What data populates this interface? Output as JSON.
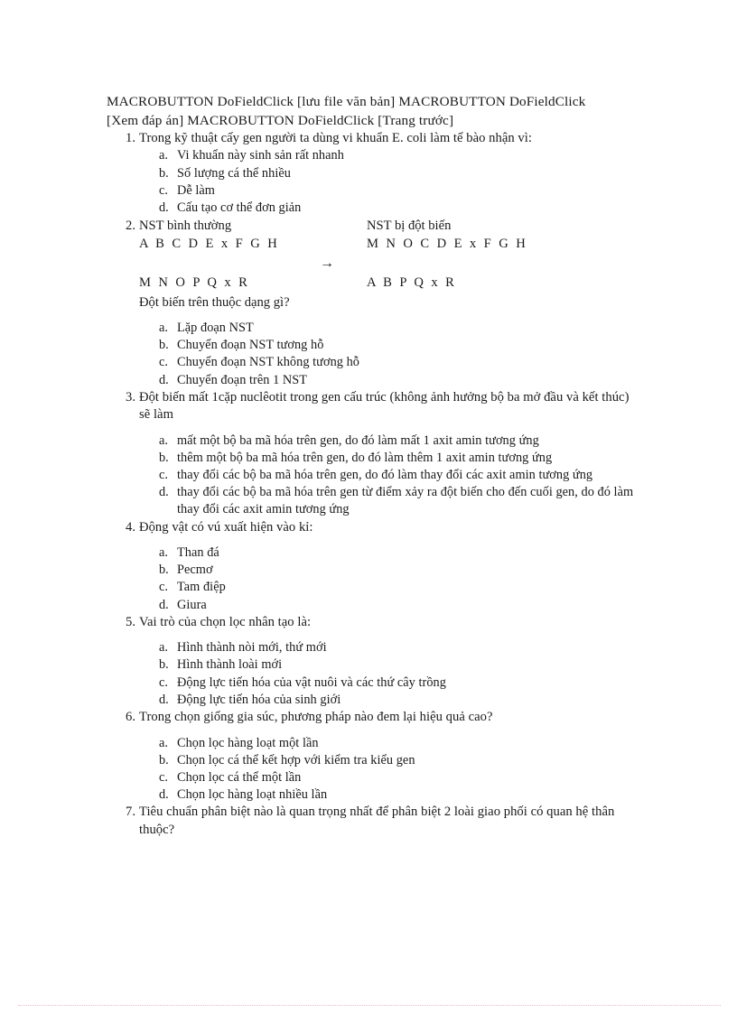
{
  "document": {
    "header_lines": [
      "MACROBUTTON DoFieldClick   [lưu file văn bản] MACROBUTTON DoFieldClick",
      "[Xem đáp án] MACROBUTTON DoFieldClick   [Trang trước]"
    ],
    "questions": [
      {
        "number": "1.",
        "text": "Trong kỹ thuật cấy gen người ta dùng vi khuẩn E. coli làm tế bào nhận vì:",
        "options": [
          {
            "letter": "a.",
            "text": "Vi khuẩn này sinh sản rất nhanh"
          },
          {
            "letter": "b.",
            "text": "Số lượng cá thể nhiều"
          },
          {
            "letter": "c.",
            "text": "Dễ làm"
          },
          {
            "letter": "d.",
            "text": "Cấu tạo cơ thể đơn giản"
          }
        ]
      },
      {
        "number": "2.",
        "text": "NST bình thường",
        "diagram": {
          "label_left": "NST bình thường",
          "label_right": "NST bị đột biến",
          "seq_left_top": "A B C D E x F G H",
          "seq_right_top": "M N O C D E x F G H",
          "arrow": "→",
          "seq_left_bottom": "M N O P Q x R",
          "seq_right_bottom": "A B P Q x R",
          "prompt": "Đột biến trên thuộc dạng gì?"
        },
        "options": [
          {
            "letter": "a.",
            "text": "Lặp đoạn NST"
          },
          {
            "letter": "b.",
            "text": "Chuyển đoạn NST tương hỗ"
          },
          {
            "letter": "c.",
            "text": "Chuyển đoạn NST không tương hỗ"
          },
          {
            "letter": "d.",
            "text": "Chuyển đoạn trên 1 NST"
          }
        ]
      },
      {
        "number": "3.",
        "text": "Đột biến mất 1cặp nuclêotit  trong gen cấu trúc (không ảnh hưởng bộ ba mở đầu và kết thúc) sẽ làm",
        "options": [
          {
            "letter": "a.",
            "text": "mất một bộ ba mã hóa trên gen, do đó làm mất 1 axit amin tương ứng"
          },
          {
            "letter": "b.",
            "text": "thêm một bộ ba mã hóa trên gen, do đó làm thêm 1 axit amin tương ứng"
          },
          {
            "letter": "c.",
            "text": "thay đổi các bộ ba mã hóa trên gen, do đó làm thay đổi các axit amin tương ứng"
          },
          {
            "letter": "d.",
            "text": "thay đổi các bộ ba mã hóa trên gen từ điểm xảy ra đột biến cho đến cuối gen, do đó làm thay đổi các axit amin tương ứng"
          }
        ]
      },
      {
        "number": "4.",
        "text": "Động vật có vú xuất hiện vào kỉ:",
        "options": [
          {
            "letter": "a.",
            "text": "Than đá"
          },
          {
            "letter": "b.",
            "text": "Pecmơ"
          },
          {
            "letter": "c.",
            "text": "Tam điệp"
          },
          {
            "letter": "d.",
            "text": "Giura"
          }
        ]
      },
      {
        "number": "5.",
        "text": "Vai trò của chọn lọc nhân tạo là:",
        "options": [
          {
            "letter": "a.",
            "text": "Hình thành nòi mới, thứ mới"
          },
          {
            "letter": "b.",
            "text": "Hình thành loài mới"
          },
          {
            "letter": "c.",
            "text": "Động lực tiến hóa của vật nuôi và các thứ cây trồng"
          },
          {
            "letter": "d.",
            "text": "Động lực tiến hóa của sinh giới"
          }
        ]
      },
      {
        "number": "6.",
        "text": "Trong chọn giống gia súc, phương pháp nào đem lại hiệu quả cao?",
        "options": [
          {
            "letter": "a.",
            "text": "Chọn lọc hàng loạt một lần"
          },
          {
            "letter": "b.",
            "text": "Chọn lọc cá thể kết hợp với kiểm tra kiểu gen"
          },
          {
            "letter": "c.",
            "text": "Chọn lọc cá thể một lần"
          },
          {
            "letter": "d.",
            "text": "Chọn lọc hàng loạt nhiều lần"
          }
        ]
      },
      {
        "number": "7.",
        "text": "Tiêu chuẩn phân biệt nào là quan trọng nhất để phân biệt 2 loài giao phối có quan hệ thân thuộc?",
        "options": []
      }
    ]
  }
}
